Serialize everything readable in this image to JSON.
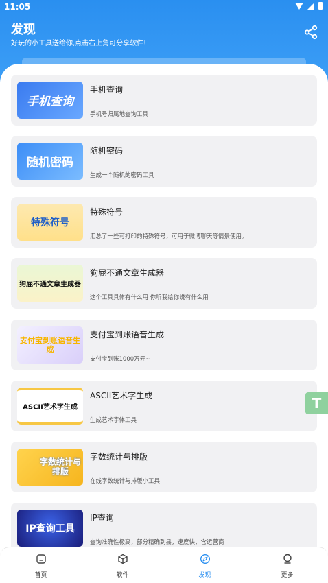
{
  "status": {
    "time": "11:05"
  },
  "header": {
    "title": "发现",
    "subtitle": "好玩的小工具送给你,点击右上角可分享软件!",
    "share_icon": "share-icon",
    "color": "#2a8ff0"
  },
  "tools": [
    {
      "thumb_text": "手机查询",
      "title": "手机查询",
      "desc": "手机号归属地查询工具"
    },
    {
      "thumb_text": "随机密码",
      "title": "随机密码",
      "desc": "生成一个随机的密码工具"
    },
    {
      "thumb_text": "特殊符号",
      "title": "特殊符号",
      "desc": "汇总了一些可打印的特殊符号，可用于微博聊天等情景使用。"
    },
    {
      "thumb_text": "狗屁不通文章生成器",
      "title": "狗屁不通文章生成器",
      "desc": "这个工具具体有什么用 你听我给你说有什么用"
    },
    {
      "thumb_text": "支付宝到账语音生成",
      "title": "支付宝到账语音生成",
      "desc": "支付宝到账1000万元~"
    },
    {
      "thumb_text": "ASCII艺术字生成",
      "title": "ASCII艺术字生成",
      "desc": "生成艺术字体工具"
    },
    {
      "thumb_text": "字数统计与排版",
      "title": "字数统计与排版",
      "desc": "在线字数统计与排版小工具"
    },
    {
      "thumb_text": "IP查询工具",
      "title": "IP查询",
      "desc": "查询准确性极高，部分精确到县，速度快，含运营商"
    }
  ],
  "float_button": {
    "label": "T"
  },
  "bottom_nav": [
    {
      "label": "首页",
      "icon": "home-icon"
    },
    {
      "label": "软件",
      "icon": "box-icon"
    },
    {
      "label": "发现",
      "icon": "compass-icon",
      "active": true
    },
    {
      "label": "更多",
      "icon": "user-icon"
    }
  ]
}
